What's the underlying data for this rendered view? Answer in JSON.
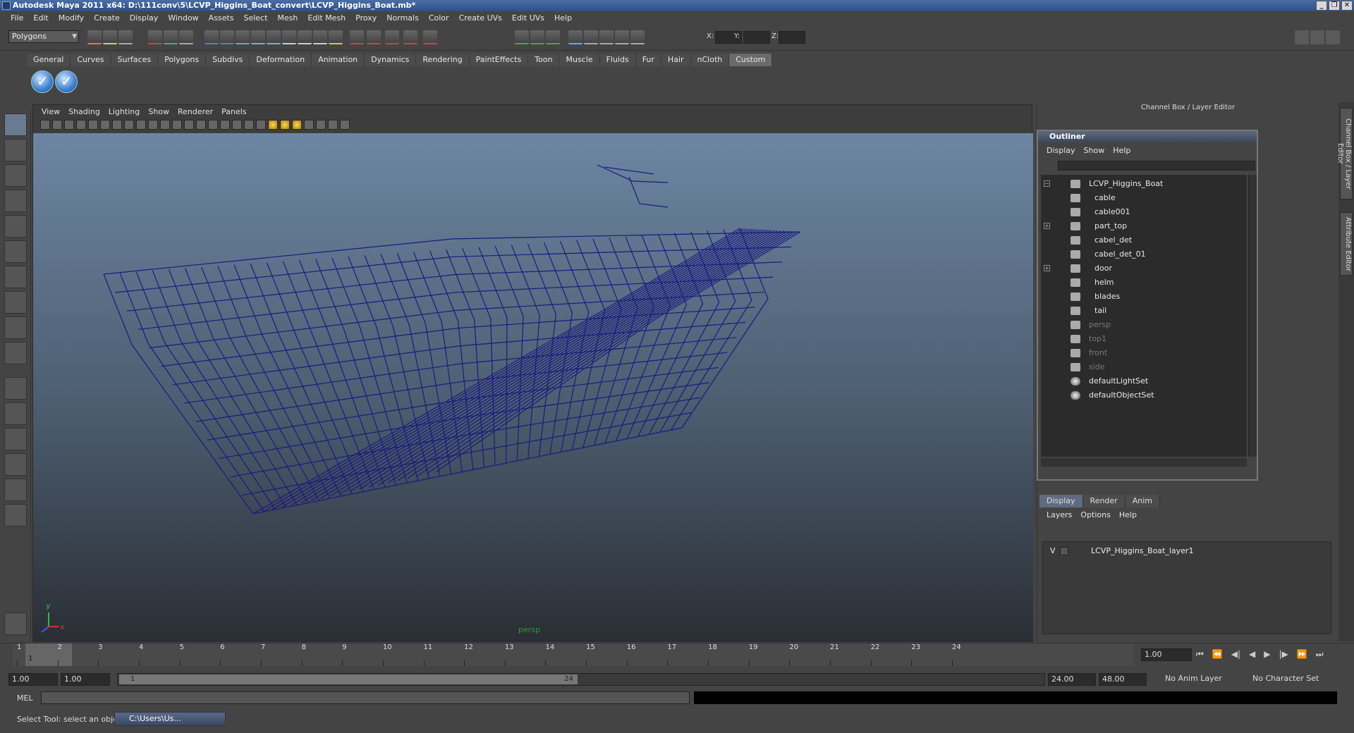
{
  "window": {
    "title": "Autodesk Maya 2011 x64: D:\\111conv\\5\\LCVP_Higgins_Boat_convert\\LCVP_Higgins_Boat.mb*",
    "buttons": [
      "_",
      "❐",
      "✕"
    ]
  },
  "menubar": [
    "File",
    "Edit",
    "Modify",
    "Create",
    "Display",
    "Window",
    "Assets",
    "Select",
    "Mesh",
    "Edit Mesh",
    "Proxy",
    "Normals",
    "Color",
    "Create UVs",
    "Edit UVs",
    "Help"
  ],
  "statusline": {
    "mode": "Polygons",
    "x_label": "X:",
    "y_label": "Y:",
    "z_label": "Z:"
  },
  "shelf": {
    "tabs": [
      "General",
      "Curves",
      "Surfaces",
      "Polygons",
      "Subdivs",
      "Deformation",
      "Animation",
      "Dynamics",
      "Rendering",
      "PaintEffects",
      "Toon",
      "Muscle",
      "Fluids",
      "Fur",
      "Hair",
      "nCloth",
      "Custom"
    ],
    "active_tab": "Custom"
  },
  "viewport": {
    "menu": [
      "View",
      "Shading",
      "Lighting",
      "Show",
      "Renderer",
      "Panels"
    ],
    "camera_label": "persp",
    "axis_y": "y",
    "axis_x": "x",
    "wire_color": "#1a1a80"
  },
  "channelbox": {
    "title": "Channel Box / Layer Editor"
  },
  "sidetabs": [
    "Channel Box / Layer Editor",
    "Attribute Editor"
  ],
  "outliner": {
    "title": "Outliner",
    "menu": [
      "Display",
      "Show",
      "Help"
    ],
    "items": [
      {
        "label": "LCVP_Higgins_Boat",
        "level": 0,
        "expand": "−",
        "dim": false,
        "icon": "group-icon"
      },
      {
        "label": "cable",
        "level": 1,
        "expand": "",
        "dim": false,
        "icon": "mesh-icon"
      },
      {
        "label": "cable001",
        "level": 1,
        "expand": "",
        "dim": false,
        "icon": "mesh-icon"
      },
      {
        "label": "part_top",
        "level": 1,
        "expand": "+",
        "dim": false,
        "icon": "mesh-icon"
      },
      {
        "label": "cabel_det",
        "level": 1,
        "expand": "",
        "dim": false,
        "icon": "mesh-icon"
      },
      {
        "label": "cabel_det_01",
        "level": 1,
        "expand": "",
        "dim": false,
        "icon": "mesh-icon"
      },
      {
        "label": "door",
        "level": 1,
        "expand": "+",
        "dim": false,
        "icon": "mesh-icon"
      },
      {
        "label": "helm",
        "level": 1,
        "expand": "",
        "dim": false,
        "icon": "mesh-icon"
      },
      {
        "label": "blades",
        "level": 1,
        "expand": "",
        "dim": false,
        "icon": "mesh-icon"
      },
      {
        "label": "tail",
        "level": 1,
        "expand": "",
        "dim": false,
        "icon": "mesh-icon"
      },
      {
        "label": "persp",
        "level": 0,
        "expand": "",
        "dim": true,
        "icon": "camera-icon"
      },
      {
        "label": "top1",
        "level": 0,
        "expand": "",
        "dim": true,
        "icon": "camera-icon"
      },
      {
        "label": "front",
        "level": 0,
        "expand": "",
        "dim": true,
        "icon": "camera-icon"
      },
      {
        "label": "side",
        "level": 0,
        "expand": "",
        "dim": true,
        "icon": "camera-icon"
      },
      {
        "label": "defaultLightSet",
        "level": 0,
        "expand": "",
        "dim": false,
        "icon": "set-icon"
      },
      {
        "label": "defaultObjectSet",
        "level": 0,
        "expand": "",
        "dim": false,
        "icon": "set-icon"
      }
    ]
  },
  "layers": {
    "tabs": [
      "Display",
      "Render",
      "Anim"
    ],
    "active_tab": "Display",
    "menu": [
      "Layers",
      "Options",
      "Help"
    ],
    "row": {
      "visible": "V",
      "name": "LCVP_Higgins_Boat_layer1"
    }
  },
  "timeslider": {
    "frames": [
      "1",
      "2",
      "3",
      "4",
      "5",
      "6",
      "7",
      "8",
      "9",
      "10",
      "11",
      "12",
      "13",
      "14",
      "15",
      "16",
      "17",
      "18",
      "19",
      "20",
      "21",
      "22",
      "23",
      "24"
    ],
    "current_frame": "1",
    "current_time": "1.00"
  },
  "range": {
    "start": "1.00",
    "playback_start": "1.00",
    "handle_start": "1",
    "handle_end": "24",
    "playback_end": "24.00",
    "end": "48.00",
    "anim_layer": "No Anim Layer",
    "char_set": "No Character Set"
  },
  "cmdline": {
    "label": "MEL"
  },
  "helpline": {
    "text": "Select Tool: select an object",
    "task": "C:\\Users\\Us..."
  }
}
